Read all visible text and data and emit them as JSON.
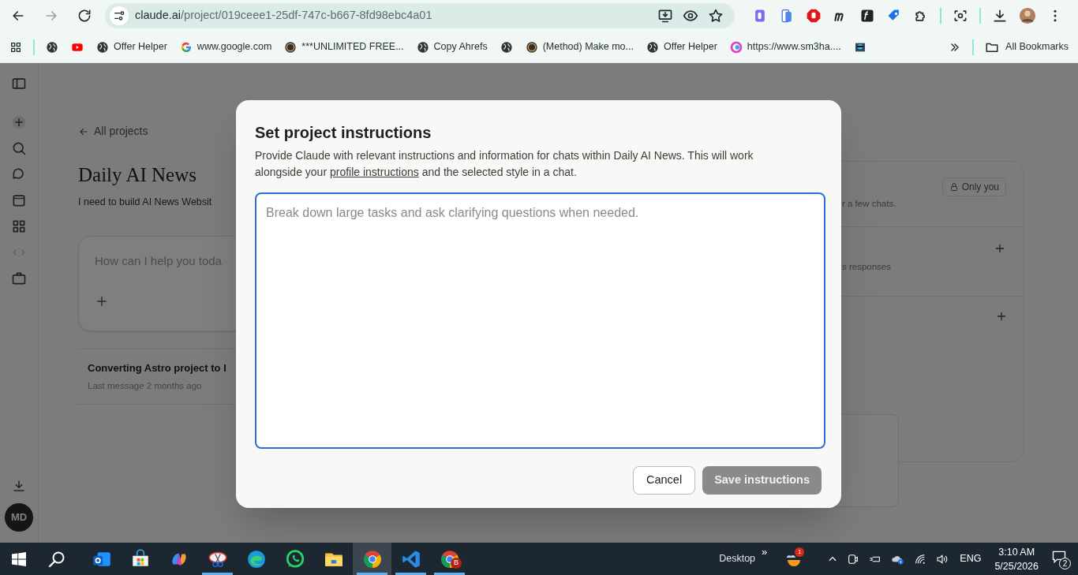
{
  "browser": {
    "url_host": "claude.ai",
    "url_path": "/project/019ceee1-25df-747c-b667-8fd98ebc4a01",
    "bookmarks": [
      {
        "kind": "globe"
      },
      {
        "kind": "youtube"
      },
      {
        "kind": "globe",
        "label": "Offer Helper"
      },
      {
        "kind": "google",
        "label": "www.google.com"
      },
      {
        "kind": "bhw",
        "label": "***UNLIMITED FREE..."
      },
      {
        "kind": "globe",
        "label": "Copy Ahrefs"
      },
      {
        "kind": "globe"
      },
      {
        "kind": "bhw",
        "label": "(Method) Make mo..."
      },
      {
        "kind": "globe",
        "label": "Offer Helper"
      },
      {
        "kind": "ring",
        "label": "https://www.sm3ha...."
      },
      {
        "kind": "thumb"
      }
    ],
    "all_bookmarks": "All Bookmarks"
  },
  "page": {
    "back_link": "All projects",
    "project_title": "Daily AI News",
    "project_description": "I need to build AI News Websit",
    "chat_placeholder": "How can I help you toda",
    "chats": [
      {
        "title": "Converting Astro project to I",
        "meta": "Last message 2 months ago"
      }
    ],
    "visibility": "Only you",
    "panel_texts": [
      "r a few chats.",
      "s responses"
    ],
    "avatar": "MD"
  },
  "dialog": {
    "title": "Set project instructions",
    "description": "Provide Claude with relevant instructions and information for chats within Daily AI News. This will work alongside your ",
    "link": "profile instructions",
    "description_end": " and the selected style in a chat.",
    "placeholder": "Break down large tasks and ask clarifying questions when needed.",
    "cancel": "Cancel",
    "save": "Save instructions",
    "save_disabled": true
  },
  "taskbar": {
    "apps": [
      {
        "kind": "outlook",
        "running": false,
        "selected": false
      },
      {
        "kind": "store",
        "running": false,
        "selected": false
      },
      {
        "kind": "copilot",
        "running": false,
        "selected": false
      },
      {
        "kind": "snip",
        "running": true,
        "selected": false
      },
      {
        "kind": "edge",
        "running": false,
        "selected": false
      },
      {
        "kind": "whatsapp",
        "running": false,
        "selected": false
      },
      {
        "kind": "folder",
        "running": false,
        "selected": false
      },
      {
        "kind": "chrome",
        "running": true,
        "selected": true
      },
      {
        "kind": "vscode",
        "running": true,
        "selected": false
      },
      {
        "kind": "chrome",
        "running": true,
        "selected": false,
        "badge": "B"
      }
    ],
    "desktop": "Desktop",
    "chevron": "»",
    "weather_badge": "1",
    "language": "ENG",
    "time": "3:10 AM",
    "date": "5/25/2026",
    "notifications": "2"
  }
}
